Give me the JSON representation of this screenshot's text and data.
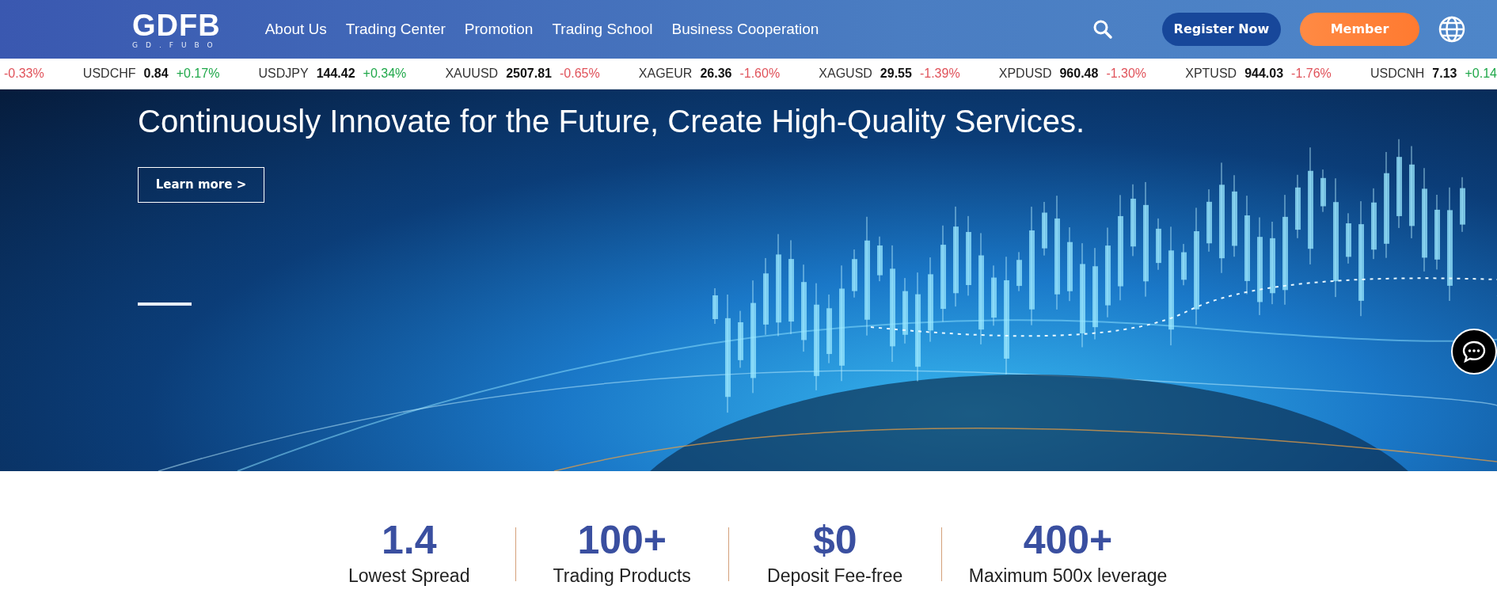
{
  "header": {
    "logo": {
      "mark": "GDFB",
      "subtitle": "GD.FUBO"
    },
    "nav": [
      {
        "label": "About Us"
      },
      {
        "label": "Trading Center"
      },
      {
        "label": "Promotion"
      },
      {
        "label": "Trading School"
      },
      {
        "label": "Business Cooperation"
      }
    ],
    "register_button": "Register Now",
    "member_button": "Member"
  },
  "ticker": [
    {
      "change": "-0.33%",
      "color": "#e0525a"
    },
    {
      "symbol": "USDCHF",
      "price": "0.84",
      "change": "+0.17%",
      "color": "#20a84a"
    },
    {
      "symbol": "USDJPY",
      "price": "144.42",
      "change": "+0.34%",
      "color": "#20a84a"
    },
    {
      "symbol": "XAUUSD",
      "price": "2507.81",
      "change": "-0.65%",
      "color": "#e0525a"
    },
    {
      "symbol": "XAGEUR",
      "price": "26.36",
      "change": "-1.60%",
      "color": "#e0525a"
    },
    {
      "symbol": "XAGUSD",
      "price": "29.55",
      "change": "-1.39%",
      "color": "#e0525a"
    },
    {
      "symbol": "XPDUSD",
      "price": "960.48",
      "change": "-1.30%",
      "color": "#e0525a"
    },
    {
      "symbol": "XPTUSD",
      "price": "944.03",
      "change": "-1.76%",
      "color": "#e0525a"
    },
    {
      "symbol": "USDCNH",
      "price": "7.13",
      "change": "+0.14",
      "color": "#20a84a"
    }
  ],
  "hero": {
    "title": "Continuously Innovate for the Future, Create High-Quality Services.",
    "button": "Learn more >"
  },
  "stats": [
    {
      "value": "1.4",
      "label": "Lowest Spread"
    },
    {
      "value": "100+",
      "label": "Trading Products"
    },
    {
      "value": "$0",
      "label": "Deposit Fee-free"
    },
    {
      "value": "400+",
      "label": "Maximum 500x leverage"
    }
  ]
}
